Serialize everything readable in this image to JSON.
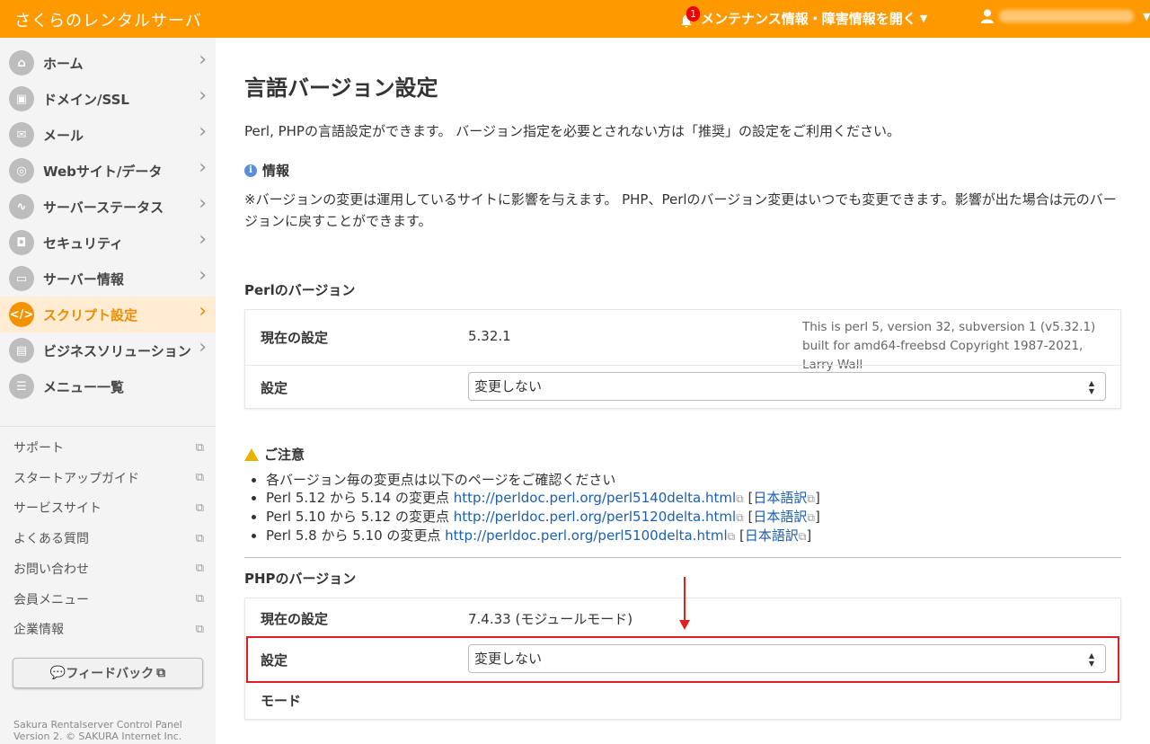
{
  "header": {
    "brand": "さくらのレンタルサーバ",
    "notice_count": "1",
    "notice_label": "メンテナンス情報・障害情報を開く"
  },
  "sidebar": {
    "items": [
      {
        "label": "ホーム",
        "icon": "home-icon",
        "glyph": "⌂"
      },
      {
        "label": "ドメイン/SSL",
        "icon": "lock-icon",
        "glyph": "▣"
      },
      {
        "label": "メール",
        "icon": "mail-icon",
        "glyph": "✉"
      },
      {
        "label": "Webサイト/データ",
        "icon": "globe-icon",
        "glyph": "◎"
      },
      {
        "label": "サーバーステータス",
        "icon": "chart-icon",
        "glyph": "∿"
      },
      {
        "label": "セキュリティ",
        "icon": "padlock-icon",
        "glyph": "◘"
      },
      {
        "label": "サーバー情報",
        "icon": "server-icon",
        "glyph": "▭"
      },
      {
        "label": "スクリプト設定",
        "icon": "script-icon",
        "glyph": "</>"
      },
      {
        "label": "ビジネスソリューション",
        "icon": "briefcase-icon",
        "glyph": "▤"
      },
      {
        "label": "メニュー一覧",
        "icon": "list-icon",
        "glyph": "☰"
      }
    ],
    "links": [
      "サポート",
      "スタートアップガイド",
      "サービスサイト",
      "よくある質問",
      "お問い合わせ",
      "会員メニュー",
      "企業情報"
    ],
    "feedback_label": "フィードバック",
    "copyright_line1": "Sakura Rentalserver Control Panel",
    "copyright_line2": "Version 2. © SAKURA Internet Inc."
  },
  "main": {
    "title": "言語バージョン設定",
    "lead": "Perl, PHPの言語設定ができます。 バージョン指定を必要とされない方は「推奨」の設定をご利用ください。",
    "info_title": "情報",
    "info_text": "※バージョンの変更は運用しているサイトに影響を与えます。 PHP、Perlのバージョン変更はいつでも変更できます。影響が出た場合は元のバージョンに戻すことができます。",
    "perl": {
      "section_title": "Perlのバージョン",
      "current_label": "現在の設定",
      "current_value": "5.32.1",
      "note": "This is perl 5, version 32, subversion 1 (v5.32.1) built for amd64-freebsd Copyright 1987-2021, Larry Wall",
      "setting_label": "設定",
      "setting_value": "変更しない"
    },
    "caution": {
      "title": "ご注意",
      "intro": "各バージョン毎の変更点は以下のページをご確認ください",
      "items": [
        {
          "prefix": "Perl 5.12 から 5.14 の変更点 ",
          "url": "http://perldoc.perl.org/perl5140delta.html",
          "jp": "日本語訳"
        },
        {
          "prefix": "Perl 5.10 から 5.12 の変更点 ",
          "url": "http://perldoc.perl.org/perl5120delta.html",
          "jp": "日本語訳"
        },
        {
          "prefix": "Perl 5.8 から 5.10 の変更点 ",
          "url": "http://perldoc.perl.org/perl5100delta.html",
          "jp": "日本語訳"
        }
      ]
    },
    "php": {
      "section_title": "PHPのバージョン",
      "current_label": "現在の設定",
      "current_value": "7.4.33 (モジュールモード)",
      "setting_label": "設定",
      "setting_value": "変更しない",
      "mode_label": "モード"
    }
  },
  "colors": {
    "brand": "#ff9900",
    "active_bg": "#ffecd2",
    "active_fg": "#f08c00",
    "link": "#1a5fb4",
    "highlight": "#e02020"
  }
}
